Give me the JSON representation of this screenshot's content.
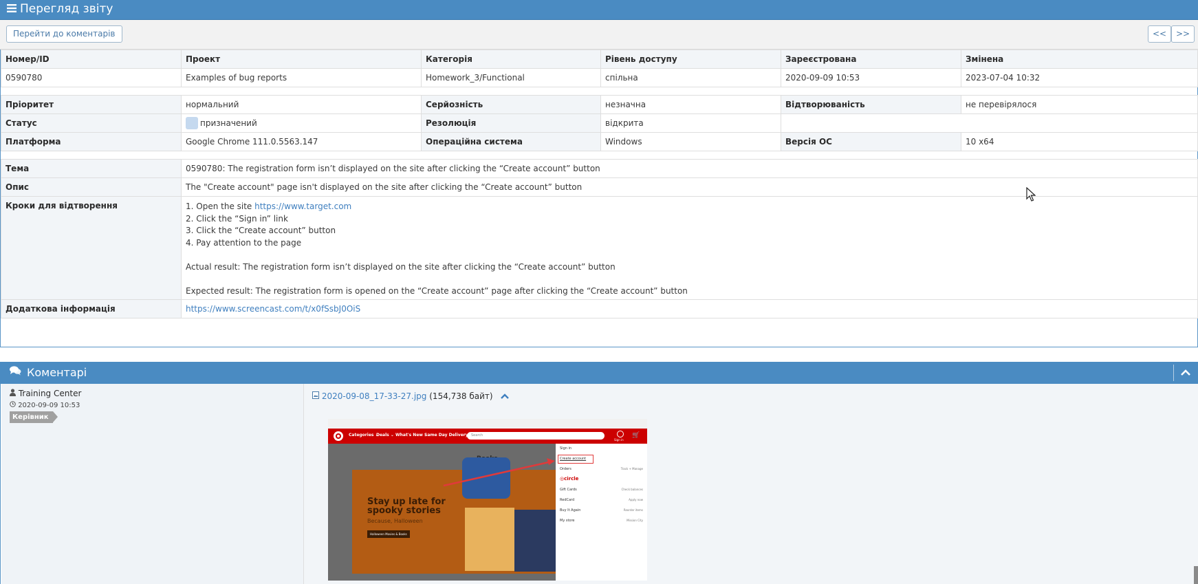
{
  "header": {
    "title": "Перегляд звіту"
  },
  "toolbar": {
    "goto_comments": "Перейти до коментарів",
    "prev": "<<",
    "next": ">>"
  },
  "summary": {
    "headers": [
      "Номер/ID",
      "Проект",
      "Категорія",
      "Рівень доступу",
      "Зареєстрована",
      "Змінена"
    ],
    "values": [
      "0590780",
      "Examples of bug reports",
      "Homework_3/Functional",
      "спільна",
      "2020-09-09 10:53",
      "2023-07-04 10:32"
    ]
  },
  "details": {
    "priority_label": "Пріоритет",
    "priority": "нормальний",
    "severity_label": "Серйозність",
    "severity": "незначна",
    "reproducibility_label": "Відтворюваність",
    "reproducibility": "не перевірялося",
    "status_label": "Статус",
    "status": "призначений",
    "status_color": "#c5d9ef",
    "resolution_label": "Резолюція",
    "resolution": "відкрита",
    "platform_label": "Платформа",
    "platform": "Google Chrome 111.0.5563.147",
    "os_label": "Операційна система",
    "os": "Windows",
    "os_version_label": "Версія ОС",
    "os_version": "10 x64"
  },
  "report": {
    "summary_label": "Тема",
    "summary": "0590780: The registration form isn’t displayed on the site after clicking the “Create account” button",
    "description_label": "Опис",
    "description": "The \"Create account\" page isn't displayed on the site after clicking the “Create account” button",
    "steps_label": "Кроки для відтворення",
    "steps": {
      "step1_prefix": "1. Open the site ",
      "step1_link": "https://www.target.com",
      "step2": "2. Click the “Sign in” link",
      "step3": "3. Click the “Create account” button",
      "step4": "4. Pay attention to the page",
      "actual": "Actual result: The registration form isn’t displayed on the site after clicking the “Create account” button",
      "expected": "Expected result: The registration form is opened on the “Create account” page after clicking the “Create account” button"
    },
    "additional_label": "Додаткова інформація",
    "additional_link": "https://www.screencast.com/t/x0fSsbJ0OiS"
  },
  "comments": {
    "title": "Коментарі",
    "author": "Training Center",
    "date": "2020-09-09 10:53",
    "role": "Керівник",
    "attachment_name": "2020-09-08_17-33-27.jpg",
    "attachment_size": "(154,738 байт)",
    "screenshot": {
      "nav": [
        "Categories ⌄",
        "Deals ⌄",
        "What's New ⌄",
        "Same Day Delivery"
      ],
      "search_placeholder": "Search",
      "account_label": "Sign in",
      "page_title": "Books",
      "promo_line1": "Stay up late for",
      "promo_line2": "spooky stories",
      "promo_sub": "Because, Halloween",
      "promo_button": "Halloween Movies & Books",
      "menu": [
        {
          "left": "Sign in",
          "right": ""
        },
        {
          "left": "Create account",
          "right": ""
        },
        {
          "left": "Orders",
          "right": "Track + Manage"
        },
        {
          "left": "◎circle",
          "right": ""
        },
        {
          "left": "Gift Cards",
          "right": "Check balances"
        },
        {
          "left": "RedCard",
          "right": "Apply now"
        },
        {
          "left": "Buy It Again",
          "right": "Reorder items"
        },
        {
          "left": "My store",
          "right": "Mission City"
        }
      ]
    }
  }
}
